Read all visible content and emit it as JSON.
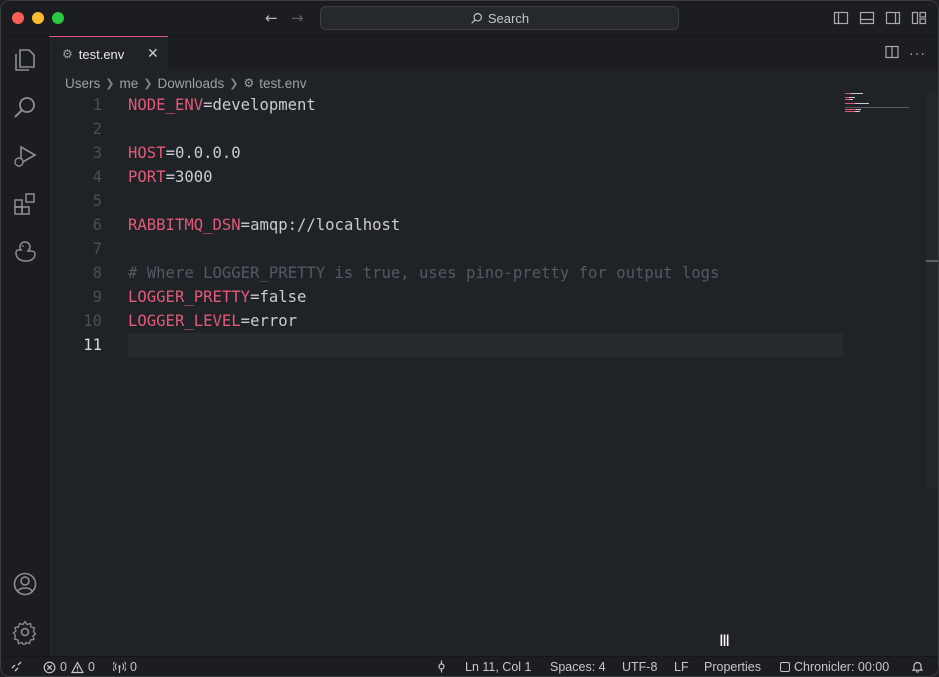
{
  "titlebar": {
    "search_label": "Search"
  },
  "tab": {
    "label": "test.env"
  },
  "breadcrumb": [
    "Users",
    "me",
    "Downloads",
    "test.env"
  ],
  "editor": {
    "lines": [
      {
        "n": "1",
        "key": "NODE_ENV",
        "eq": "=",
        "val": "development"
      },
      {
        "n": "2"
      },
      {
        "n": "3",
        "key": "HOST",
        "eq": "=",
        "val": "0.0.0.0"
      },
      {
        "n": "4",
        "key": "PORT",
        "eq": "=",
        "val": "3000"
      },
      {
        "n": "5"
      },
      {
        "n": "6",
        "key": "RABBITMQ_DSN",
        "eq": "=",
        "val": "amqp://localhost"
      },
      {
        "n": "7"
      },
      {
        "n": "8",
        "comment": "# Where LOGGER_PRETTY is true, uses pino-pretty for output logs"
      },
      {
        "n": "9",
        "key": "LOGGER_PRETTY",
        "eq": "=",
        "val": "false"
      },
      {
        "n": "10",
        "key": "LOGGER_LEVEL",
        "eq": "=",
        "val": "error"
      },
      {
        "n": "11"
      }
    ],
    "active_line": "11"
  },
  "statusbar": {
    "errors": "0",
    "warnings": "0",
    "ports": "0",
    "position": "Ln 11, Col 1",
    "spaces": "Spaces: 4",
    "encoding": "UTF-8",
    "eol": "LF",
    "language": "Properties",
    "chronicler": "Chronicler: 00:00"
  },
  "colors": {
    "accent": "#e15a7a",
    "background": "#1f2226",
    "sidebar": "#1b1d21"
  }
}
